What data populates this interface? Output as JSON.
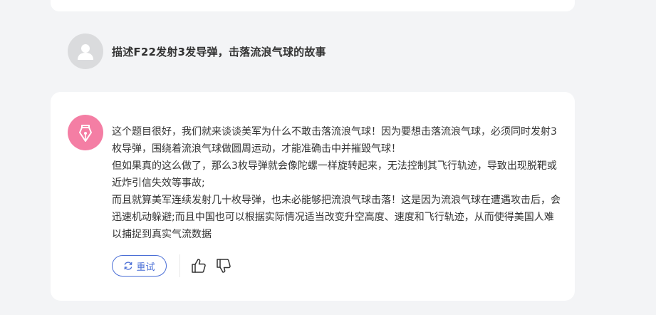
{
  "user": {
    "message": "描述F22发射3发导弹，击落流浪气球的故事"
  },
  "bot": {
    "paragraphs": [
      "这个题目很好，我们就来谈谈美军为什么不敢击落流浪气球！因为要想击落流浪气球，必须同时发射3枚导弹，围绕着流浪气球做圆周运动，才能准确击中并摧毁气球！",
      "但如果真的这么做了，那么3枚导弹就会像陀螺一样旋转起来，无法控制其飞行轨迹，导致出现脱靶或近炸引信失效等事故;",
      "而且就算美军连续发射几十枚导弹，也未必能够把流浪气球击落！这是因为流浪气球在遭遇攻击后，会迅速机动躲避;而且中国也可以根据实际情况适当改变升空高度、速度和飞行轨迹，从而使得美国人难以捕捉到真实气流数据"
    ]
  },
  "actions": {
    "retry_label": "重试"
  },
  "colors": {
    "accent": "#4b6fd6",
    "bot_avatar": "#f47ea4",
    "user_avatar": "#dadbdd",
    "background": "#f3f4f6"
  },
  "icons": {
    "user_avatar": "person-icon",
    "bot_avatar": "pen-nib-icon",
    "retry": "refresh-icon",
    "like": "thumbs-up-icon",
    "dislike": "thumbs-down-icon"
  }
}
